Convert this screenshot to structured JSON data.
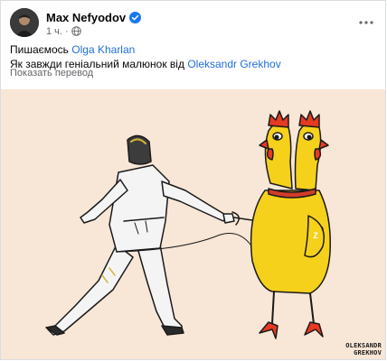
{
  "post": {
    "author": "Max Nefyodov",
    "time": "1 ч.",
    "text_line1_prefix": "Пишаємось",
    "mention1": "Olga Kharlan",
    "text_line2_prefix": "Як завжди геніальний малюнок від",
    "mention2": "Oleksandr Grekhov",
    "translate_label": "Показать перевод"
  },
  "illustration": {
    "signature_line1": "OLEKSANDR",
    "signature_line2": "GREKHOV",
    "badge_letter": "Z",
    "background": "#f8e6d6",
    "chicken_color": "#f6d11b",
    "comb_color": "#e63a22"
  },
  "icons": {
    "verified": "verified-badge-icon",
    "privacy": "globe-icon",
    "more": "more-options-icon"
  },
  "colors": {
    "link": "#216fdb",
    "secondary_text": "#65676b",
    "verified": "#1877f2"
  }
}
